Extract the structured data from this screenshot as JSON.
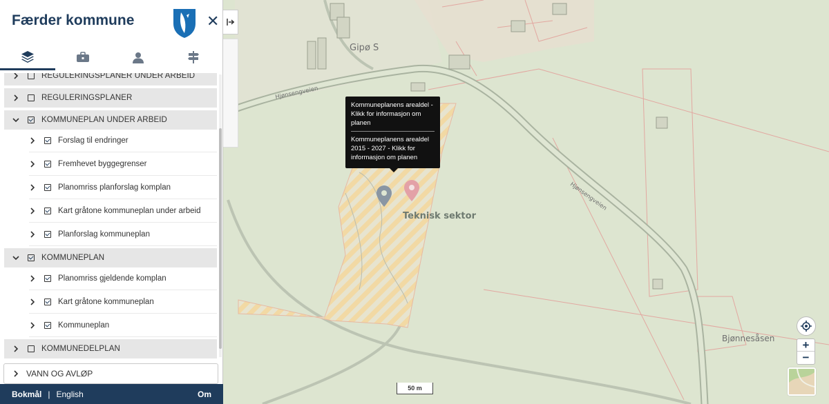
{
  "app": {
    "title": "Færder kommune"
  },
  "tabs": [
    {
      "name": "layers-icon"
    },
    {
      "name": "toolbox-icon"
    },
    {
      "name": "user-icon"
    },
    {
      "name": "signpost-icon"
    }
  ],
  "layers": {
    "partial_top": "REGULERINGSPLANER UNDER ARBEID",
    "groups": [
      {
        "label": "REGULERINGSPLANER",
        "checked": false
      },
      {
        "label": "KOMMUNEPLAN UNDER ARBEID",
        "checked": true,
        "children": [
          "Forslag til endringer",
          "Fremhevet byggegrenser",
          "Planomriss planforslag komplan",
          "Kart gråtone kommuneplan under arbeid",
          "Planforslag kommuneplan"
        ]
      },
      {
        "label": "KOMMUNEPLAN",
        "checked": true,
        "children": [
          "Planomriss gjeldende komplan",
          "Kart gråtone kommuneplan",
          "Kommuneplan"
        ]
      },
      {
        "label": "KOMMUNEDELPLAN",
        "checked": false
      }
    ]
  },
  "vann": {
    "label": "VANN OG AVLØP"
  },
  "footer": {
    "lang_active": "Bokmål",
    "lang_other": "English",
    "about": "Om"
  },
  "tooltip": {
    "line1": "Kommuneplanens arealdel - Klikk for informasjon om planen",
    "line2": "Kommuneplanens arealdel 2015 - 2027 - Klikk for informasjon om planen"
  },
  "map_labels": {
    "gipo": "Gipø S",
    "teknisk": "Teknisk sektor",
    "bjonnes": "Bjønnesåsen",
    "road1": "Hjønsengveien",
    "road2": "Hjønsengveien"
  },
  "scale": "50 m",
  "colors": {
    "brand": "#1f3c5c",
    "map_bg": "#dfe6d3",
    "hatch": "#f3d9a6"
  }
}
